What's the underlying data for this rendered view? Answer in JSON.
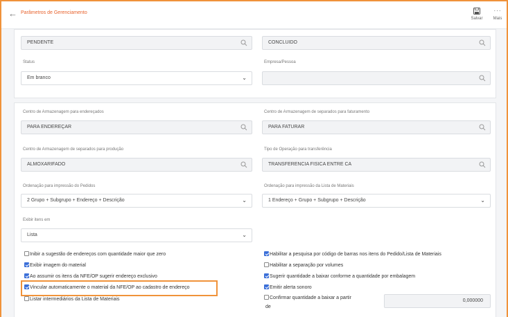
{
  "header": {
    "title": "Parâmetros de Gerenciamento",
    "save_label": "Salvar",
    "more_label": "Mais"
  },
  "section1": {
    "pendente_value": "PENDENTE",
    "concluido_value": "CONCLUIDO",
    "status_label": "Status",
    "status_value": "Em branco",
    "empresa_label": "Empresa/Pessoa",
    "empresa_value": ""
  },
  "section2": {
    "ca_enderecados_label": "Centro de Armazenagem para endereçados",
    "ca_enderecados_value": "PARA ENDEREÇAR",
    "ca_separados_fat_label": "Centro de Armazenagem de separados para faturamento",
    "ca_separados_fat_value": "PARA FATURAR",
    "ca_separados_prod_label": "Centro de Armazenagem de separados para produção",
    "ca_separados_prod_value": "ALMOXARIFADO",
    "tipo_operacao_label": "Tipo de Operação para transferência",
    "tipo_operacao_value": "TRANSFERENCIA FISICA ENTRE CA",
    "ordenacao_pedidos_label": "Ordenação para impressão do Pedidos",
    "ordenacao_pedidos_value": "2 Grupo + Subgrupo + Endereço + Descrição",
    "ordenacao_lista_label": "Ordenação para impressão da Lista de Materiais",
    "ordenacao_lista_value": "1 Endereço + Grupo + Subgrupo + Descrição",
    "exibir_itens_label": "Exibir itens em",
    "exibir_itens_value": "Lista"
  },
  "checkboxes_left": [
    {
      "label": "Inibir a sugestão de endereços com quantidade maior que zero",
      "checked": false
    },
    {
      "label": "Exibir imagem do material",
      "checked": true
    },
    {
      "label": "Ao assumir os itens da NFE/OP sugerir endereço exclusivo",
      "checked": true
    },
    {
      "label": "Vincular automaticamente o material da NFE/OP ao cadastro de endereço",
      "checked": true
    },
    {
      "label": "Listar intermediários da Lista de Materiais",
      "checked": false
    }
  ],
  "checkboxes_right": [
    {
      "label": "Habilitar a pesquisa por código de barras nos itens do Pedido/Lista de Materiais",
      "checked": true
    },
    {
      "label": "Habilitar a separação por volumes",
      "checked": false
    },
    {
      "label": "Sugerir quantidade a baixar conforme a quantidade por embalagem",
      "checked": true
    },
    {
      "label": "Emitir alerta sonoro",
      "checked": true
    },
    {
      "label": "Confirmar quantidade a baixar a partir",
      "label_line2": "de",
      "checked": false,
      "value": "0,000000"
    }
  ]
}
